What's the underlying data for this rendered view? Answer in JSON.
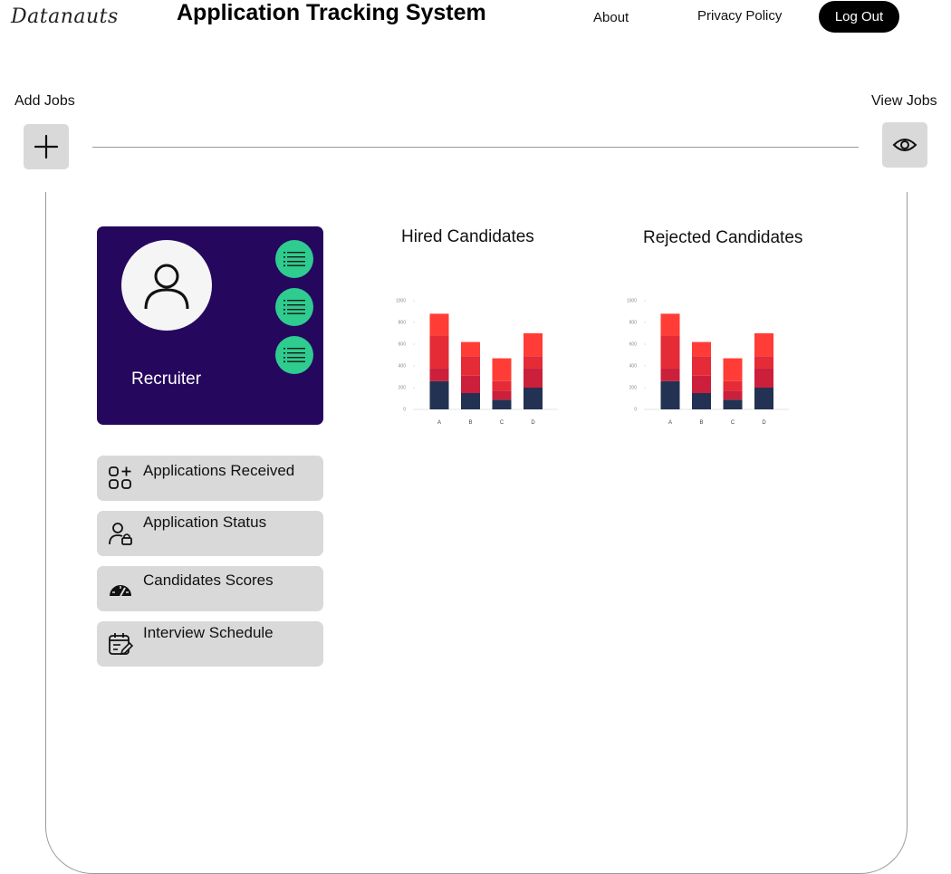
{
  "header": {
    "logo_text": "Datanauts",
    "title": "Application Tracking System",
    "nav": {
      "about": "About",
      "privacy": "Privacy Policy"
    },
    "logout_label": "Log Out"
  },
  "jobs": {
    "add_label": "Add Jobs",
    "view_label": "View Jobs",
    "add_icon": "plus-icon",
    "view_icon": "eye-icon"
  },
  "profile": {
    "role": "Recruiter",
    "avatar_icon": "user-icon",
    "quick_buttons": [
      "list-icon",
      "list-icon",
      "list-icon"
    ],
    "accent_color": "#26075e",
    "button_color": "#2ecc8f"
  },
  "menu": [
    {
      "label": "Applications Received",
      "icon": "apps-add-icon"
    },
    {
      "label": "Application Status",
      "icon": "user-lock-icon"
    },
    {
      "label": "Candidates Scores",
      "icon": "gauge-icon"
    },
    {
      "label": "Interview Schedule",
      "icon": "calendar-edit-icon"
    }
  ],
  "chart_data": [
    {
      "type": "bar",
      "stacked": true,
      "title": "Hired Candidates",
      "categories": [
        "A",
        "B",
        "C",
        "D"
      ],
      "ylim": [
        0,
        1000
      ],
      "yticks": [
        0,
        200,
        400,
        600,
        800,
        1000
      ],
      "series": [
        {
          "values": [
            260,
            150,
            90,
            200
          ],
          "color": "#233252"
        },
        {
          "values": [
            120,
            160,
            80,
            180
          ],
          "color": "#cc1f3b"
        },
        {
          "values": [
            300,
            180,
            90,
            110
          ],
          "color": "#e42b36"
        },
        {
          "values": [
            200,
            130,
            210,
            210
          ],
          "color": "#ff3d36"
        }
      ],
      "grid": false
    },
    {
      "type": "bar",
      "stacked": true,
      "title": "Rejected Candidates",
      "categories": [
        "A",
        "B",
        "C",
        "D"
      ],
      "ylim": [
        0,
        1000
      ],
      "yticks": [
        0,
        200,
        400,
        600,
        800,
        1000
      ],
      "series": [
        {
          "values": [
            260,
            150,
            90,
            200
          ],
          "color": "#233252"
        },
        {
          "values": [
            120,
            160,
            80,
            180
          ],
          "color": "#cc1f3b"
        },
        {
          "values": [
            300,
            180,
            90,
            110
          ],
          "color": "#e42b36"
        },
        {
          "values": [
            200,
            130,
            210,
            210
          ],
          "color": "#ff3d36"
        }
      ],
      "grid": false
    }
  ]
}
